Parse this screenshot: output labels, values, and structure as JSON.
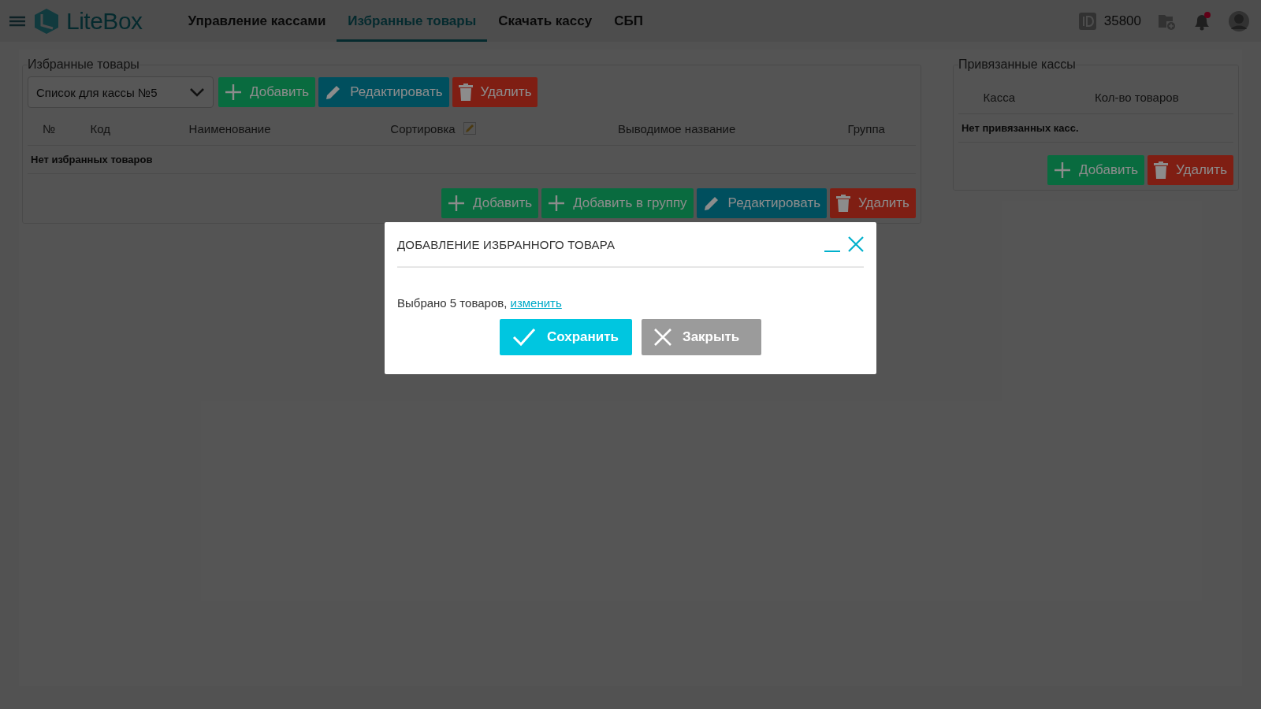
{
  "header": {
    "logo": "LiteBox",
    "nav": [
      {
        "label": "Управление кассами",
        "selected": false
      },
      {
        "label": "Избранные товары",
        "selected": true
      },
      {
        "label": "Скачать кассу",
        "selected": false
      },
      {
        "label": "СБП",
        "selected": false
      }
    ],
    "account_id": "35800",
    "has_notifications": true
  },
  "favorites": {
    "title": "Избранные товары",
    "list_select": "Список для кассы №5",
    "toolbar": [
      {
        "kind": "add",
        "label": "Добавить"
      },
      {
        "kind": "edit",
        "label": "Редактировать"
      },
      {
        "kind": "delete",
        "label": "Удалить"
      }
    ],
    "columns": [
      "№",
      "Код",
      "Наименование",
      "Сортировка",
      "Выводимое название",
      "Группа"
    ],
    "empty_message": "Нет избранных товаров",
    "actions": [
      {
        "kind": "add",
        "label": "Добавить"
      },
      {
        "kind": "add",
        "label": "Добавить в группу"
      },
      {
        "kind": "edit",
        "label": "Редактировать"
      },
      {
        "kind": "delete",
        "label": "Удалить"
      }
    ]
  },
  "linked": {
    "title": "Привязанные кассы",
    "columns": [
      "Касса",
      "Кол-во товаров"
    ],
    "empty_message": "Нет привязанных касс.",
    "actions": [
      {
        "kind": "add",
        "label": "Добавить"
      },
      {
        "kind": "delete",
        "label": "Удалить"
      }
    ]
  },
  "dialog": {
    "title": "ДОБАВЛЕНИЕ ИЗБРАННОГО ТОВАРА",
    "message": "Выбрано 5 товаров,",
    "link": "изменить",
    "buttons": [
      {
        "kind": "save",
        "label": "Сохранить"
      },
      {
        "kind": "close",
        "label": "Закрыть"
      }
    ]
  }
}
